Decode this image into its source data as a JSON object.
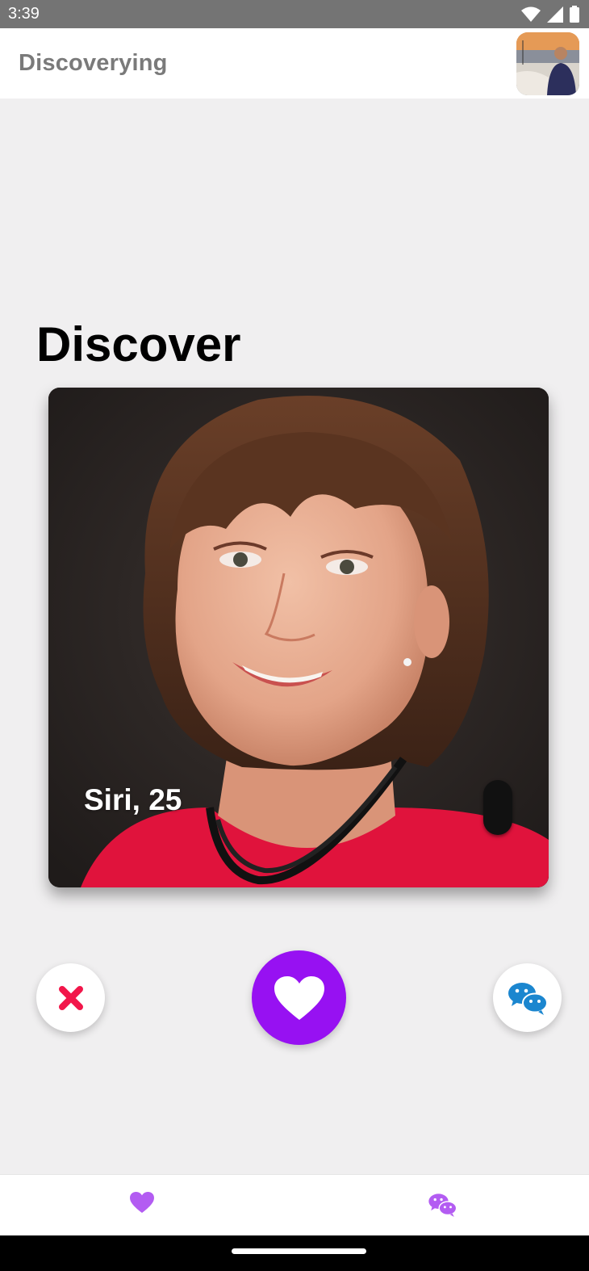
{
  "status_bar": {
    "time": "3:39",
    "icons": [
      "wifi-icon",
      "signal-icon",
      "battery-icon"
    ]
  },
  "app_bar": {
    "title": "Discoverying",
    "avatar": "profile-avatar"
  },
  "page": {
    "title": "Discover"
  },
  "card": {
    "name_age": "Siri, 25"
  },
  "actions": {
    "dislike_icon": "close-icon",
    "like_icon": "heart-icon",
    "chat_icon": "wechat-icon"
  },
  "bottom_nav": {
    "items": [
      {
        "icon": "heart-icon"
      },
      {
        "icon": "chat-bubbles-icon"
      }
    ]
  },
  "colors": {
    "accent": "#9711f2",
    "nav_icon": "#b35cf2",
    "dislike": "#f2164a",
    "chat": "#1b86cf"
  }
}
